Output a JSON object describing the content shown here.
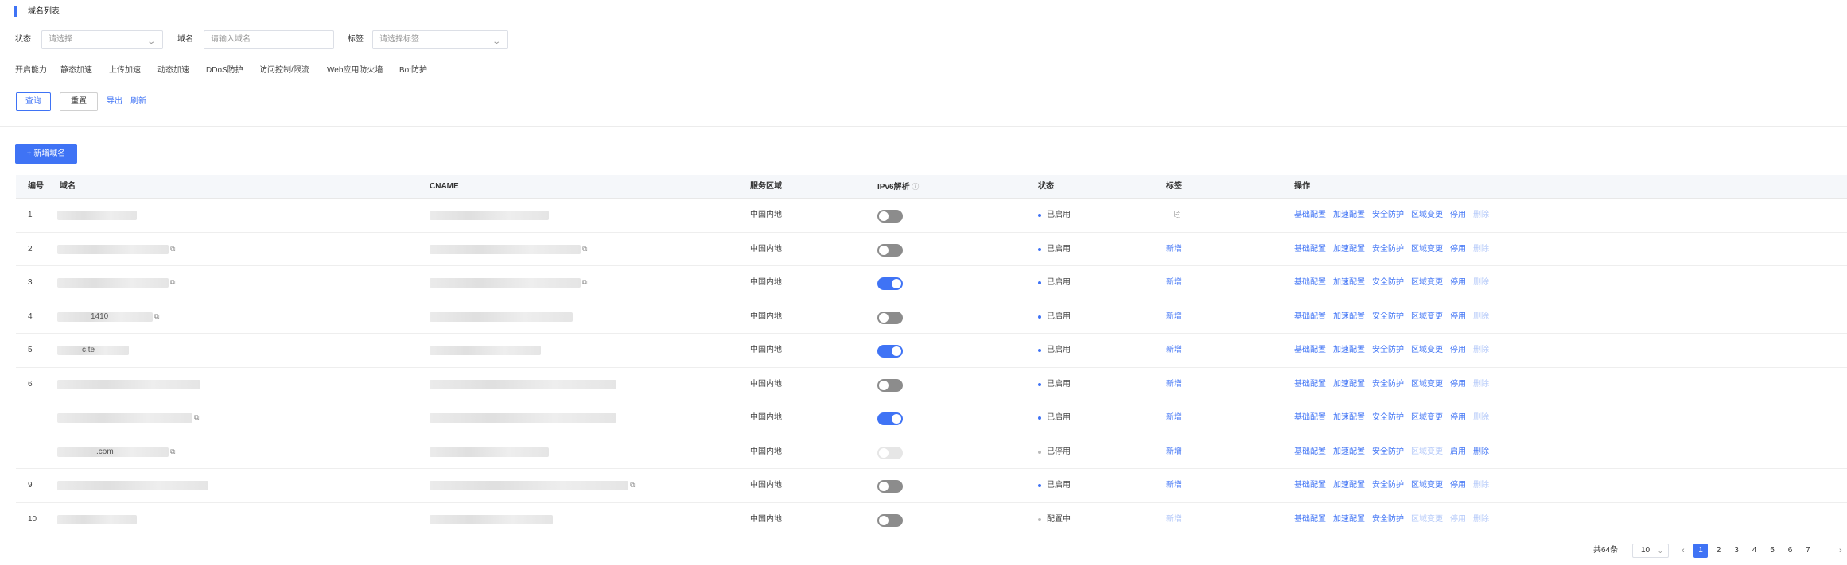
{
  "section_title": "域名列表",
  "filters": {
    "status_label": "状态",
    "status_placeholder": "请选择",
    "domain_label": "域名",
    "domain_placeholder": "请输入域名",
    "tag_label": "标签",
    "tag_placeholder": "请选择标签"
  },
  "features": [
    "开启能力",
    "静态加速",
    "上传加速",
    "动态加速",
    "DDoS防护",
    "访问控制/限流",
    "Web应用防火墙",
    "Bot防护"
  ],
  "buttons": {
    "query": "查询",
    "reset": "重置",
    "export": "导出",
    "refresh": "刷新",
    "add_domain": "新增域名",
    "add_icon": "+"
  },
  "table": {
    "headers": {
      "index": "编号",
      "domain": "域名",
      "cname": "CNAME",
      "region": "服务区域",
      "ipv6": "IPv6解析",
      "ipv6_info_icon": "ⓘ",
      "status": "状态",
      "tag": "标签",
      "actions": "操作"
    },
    "rows": [
      {
        "index": "1",
        "domain_fragment": "",
        "region": "中国内地",
        "ipv6": "off",
        "status": "已启用",
        "status_color": "blue",
        "tag": "",
        "tag_mode": "icon",
        "delete_enabled": false,
        "action_5": "停用"
      },
      {
        "index": "2",
        "domain_fragment": "",
        "region": "中国内地",
        "ipv6": "off",
        "status": "已启用",
        "status_color": "blue",
        "tag": "新增",
        "tag_mode": "link",
        "delete_enabled": false,
        "action_5": "停用"
      },
      {
        "index": "3",
        "domain_fragment": "",
        "region": "中国内地",
        "ipv6": "on",
        "status": "已启用",
        "status_color": "blue",
        "tag": "新增",
        "tag_mode": "link",
        "delete_enabled": false,
        "action_5": "停用"
      },
      {
        "index": "4",
        "domain_fragment": "1410",
        "region": "中国内地",
        "ipv6": "off",
        "status": "已启用",
        "status_color": "blue",
        "tag": "新增",
        "tag_mode": "link",
        "delete_enabled": false,
        "action_5": "停用"
      },
      {
        "index": "5",
        "domain_fragment": "c.te",
        "region": "中国内地",
        "ipv6": "on",
        "status": "已启用",
        "status_color": "blue",
        "tag": "新增",
        "tag_mode": "link",
        "delete_enabled": false,
        "action_5": "停用"
      },
      {
        "index": "6",
        "domain_fragment": "",
        "region": "中国内地",
        "ipv6": "off",
        "status": "已启用",
        "status_color": "blue",
        "tag": "新增",
        "tag_mode": "link",
        "delete_enabled": false,
        "action_5": "停用"
      },
      {
        "index": "",
        "domain_fragment": "",
        "region": "中国内地",
        "ipv6": "on",
        "status": "已启用",
        "status_color": "blue",
        "tag": "新增",
        "tag_mode": "link",
        "delete_enabled": false,
        "action_5": "停用"
      },
      {
        "index": "",
        "domain_fragment": ".com",
        "region": "中国内地",
        "ipv6": "disabled",
        "status": "已停用",
        "status_color": "gray",
        "tag": "新增",
        "tag_mode": "link",
        "delete_enabled": true,
        "action_5": "启用"
      },
      {
        "index": "9",
        "domain_fragment": "",
        "region": "中国内地",
        "ipv6": "off",
        "status": "已启用",
        "status_color": "blue",
        "tag": "新增",
        "tag_mode": "link",
        "delete_enabled": false,
        "action_5": "停用"
      },
      {
        "index": "10",
        "domain_fragment": "",
        "region": "中国内地",
        "ipv6": "off",
        "status": "配置中",
        "status_color": "gray",
        "tag": "新增",
        "tag_mode": "link-disabled",
        "delete_enabled": false,
        "action_5": "停用"
      }
    ],
    "actions": [
      "基础配置",
      "加速配置",
      "安全防护",
      "区域变更"
    ],
    "delete_label": "删除"
  },
  "pagination": {
    "total": "共64条",
    "page_size": "10",
    "pages": [
      "1",
      "2",
      "3",
      "4",
      "5",
      "6",
      "7"
    ],
    "current": "1",
    "prev_icon": "‹",
    "next_icon": "›"
  },
  "colors": {
    "accent": "#3f73f5",
    "disabled_link": "#b3c8f9"
  },
  "icons": {
    "chevron": "chevron-down-icon",
    "copy": "copy-icon",
    "info": "info-icon",
    "tag": "tag-icon"
  }
}
